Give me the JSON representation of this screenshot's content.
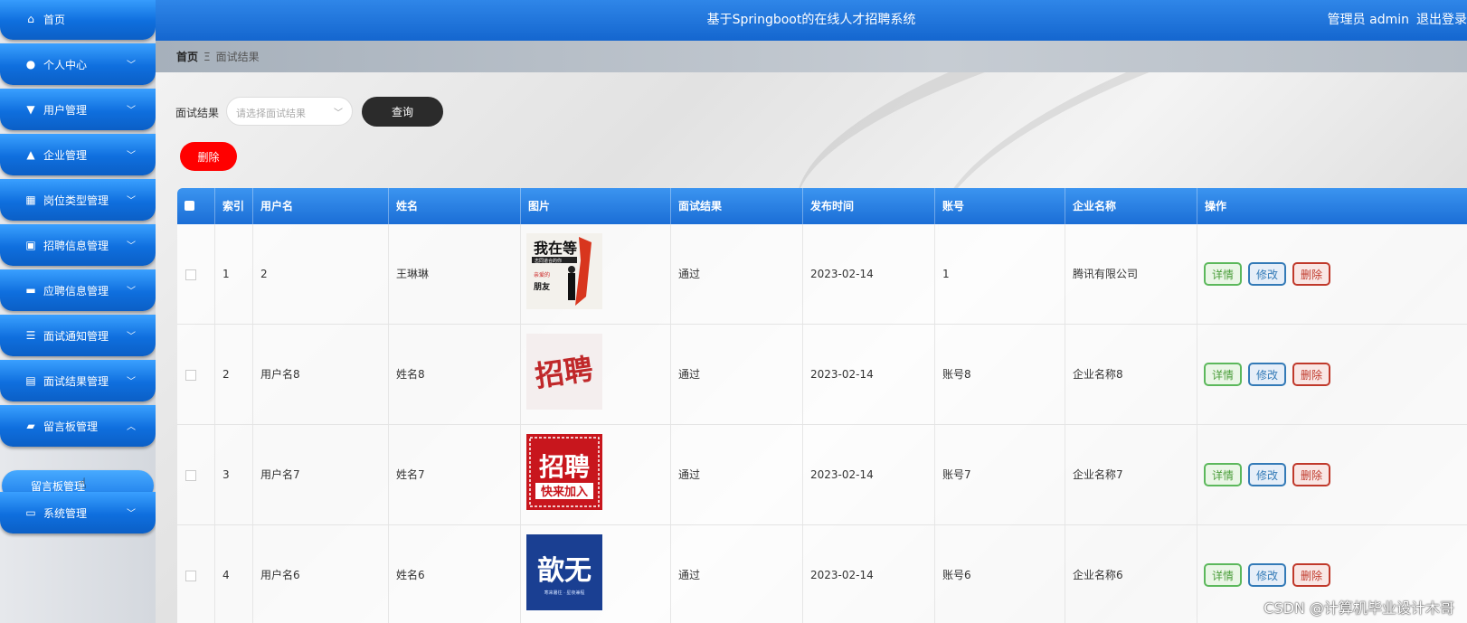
{
  "header": {
    "title": "基于Springboot的在线人才招聘系统",
    "user_label": "管理员 admin",
    "logout_label": "退出登录"
  },
  "sidebar": {
    "items": [
      {
        "label": "首页",
        "icon": "home-icon",
        "expandable": false
      },
      {
        "label": "个人中心",
        "icon": "user-icon",
        "expandable": true
      },
      {
        "label": "用户管理",
        "icon": "users-icon",
        "expandable": true
      },
      {
        "label": "企业管理",
        "icon": "building-icon",
        "expandable": true
      },
      {
        "label": "岗位类型管理",
        "icon": "grid-icon",
        "expandable": true
      },
      {
        "label": "招聘信息管理",
        "icon": "briefcase-icon",
        "expandable": true
      },
      {
        "label": "应聘信息管理",
        "icon": "chat-icon",
        "expandable": true
      },
      {
        "label": "面试通知管理",
        "icon": "list-icon",
        "expandable": true
      },
      {
        "label": "面试结果管理",
        "icon": "clipboard-icon",
        "expandable": true
      },
      {
        "label": "留言板管理",
        "icon": "bag-icon",
        "expandable": true,
        "expanded": true
      },
      {
        "label": "系统管理",
        "icon": "monitor-icon",
        "expandable": true
      }
    ],
    "submenu": {
      "label": "留言板管理"
    }
  },
  "breadcrumb": {
    "home": "首页",
    "separator": "Ξ",
    "current": "面试结果"
  },
  "filter": {
    "label": "面试结果",
    "placeholder": "请选择面试结果",
    "query_label": "查询",
    "delete_label": "删除"
  },
  "table": {
    "headers": [
      "索引",
      "用户名",
      "姓名",
      "图片",
      "面试结果",
      "发布时间",
      "账号",
      "企业名称",
      "操作"
    ],
    "rows": [
      {
        "index": "1",
        "username": "2",
        "name": "王琳琳",
        "image": "poster-icon",
        "result": "通过",
        "time": "2023-02-14",
        "account": "1",
        "company": "腾讯有限公司"
      },
      {
        "index": "2",
        "username": "用户名8",
        "name": "姓名8",
        "image": "calligraphy-icon",
        "result": "通过",
        "time": "2023-02-14",
        "account": "账号8",
        "company": "企业名称8"
      },
      {
        "index": "3",
        "username": "用户名7",
        "name": "姓名7",
        "image": "recruit-banner-icon",
        "result": "通过",
        "time": "2023-02-14",
        "account": "账号7",
        "company": "企业名称7"
      },
      {
        "index": "4",
        "username": "用户名6",
        "name": "姓名6",
        "image": "blue-poster-icon",
        "result": "通过",
        "time": "2023-02-14",
        "account": "账号6",
        "company": "企业名称6"
      }
    ],
    "actions": {
      "detail": "详情",
      "edit": "修改",
      "remove": "删除"
    }
  },
  "images": {
    "poster1": {
      "title": "我在等",
      "sub": "志同道合的你",
      "line": "亲爱的",
      "line2": "朋友"
    },
    "poster2": {
      "text": "招聘"
    },
    "poster3": {
      "big": "招聘",
      "small": "快来加入"
    },
    "poster4": {
      "big": "歆无",
      "small": "寒来暑往 · 星夜兼程"
    }
  },
  "watermark": "CSDN @计算机毕业设计木哥",
  "colors": {
    "header": "#1466cf",
    "danger": "#ff0000",
    "query": "#2b2b2b"
  }
}
